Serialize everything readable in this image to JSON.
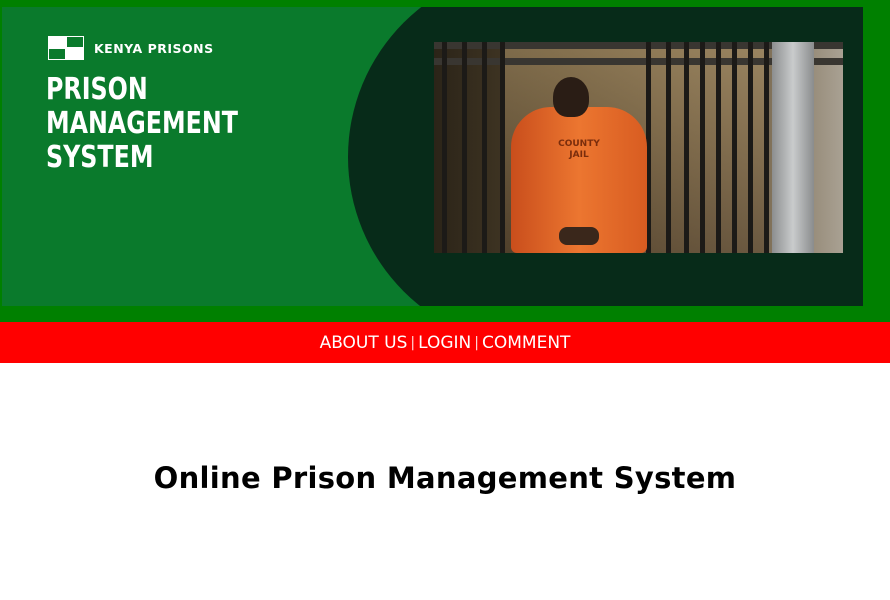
{
  "header": {
    "brand_name": "KENYA PRISONS",
    "system_title": "PRISON MANAGEMENT SYSTEM",
    "logo_icon": "checkered-flag-icon",
    "photo_caption_text": "COUNTY JAIL",
    "colors": {
      "frame": "#008000",
      "banner_green": "#0a7a2c",
      "banner_dark": "#072b19",
      "logo_white": "#ffffff",
      "logo_green": "#0a7a2c"
    }
  },
  "nav": {
    "background": "#ff0000",
    "items": [
      {
        "label": "ABOUT US"
      },
      {
        "label": "LOGIN"
      },
      {
        "label": "COMMENT"
      }
    ],
    "separator": "|"
  },
  "main": {
    "title": "Online Prison Management System"
  }
}
